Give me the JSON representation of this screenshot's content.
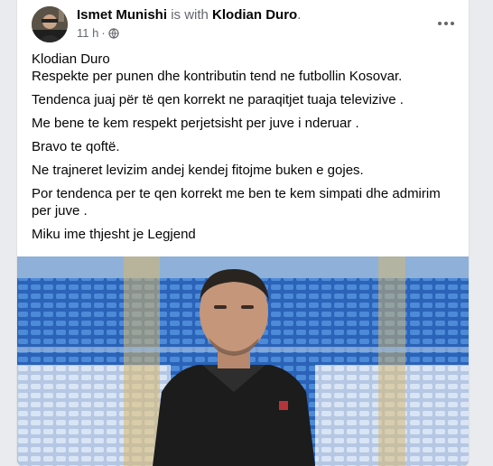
{
  "post": {
    "author": "Ismet Munishi",
    "with_text": "is with",
    "tagged": "Klodian Duro",
    "period": ".",
    "time": "11 h",
    "sep": "·",
    "privacy_icon": "globe-icon",
    "more_icon": "more-horizontal-icon",
    "lines": [
      "Klodian Duro",
      "Respekte per punen dhe kontributin tend ne futbollin Kosovar.",
      "Tendenca juaj për të qen korrekt ne paraqitjet tuaja televizive .",
      "Me bene te kem respekt perjetsisht per juve i nderuar .",
      "Bravo te qoftë.",
      "Ne trajneret  levizim andej kendej fitojme buken e gojes.",
      "Por tendenca per te qen korrekt me ben te kem simpati dhe admirim per juve .",
      "Miku ime thjesht je Legjend"
    ]
  },
  "colors": {
    "card": "#ffffff",
    "background": "#e9ebee",
    "text": "#050505",
    "secondary": "#65676b",
    "seat_blue": "#2f6bc4"
  }
}
